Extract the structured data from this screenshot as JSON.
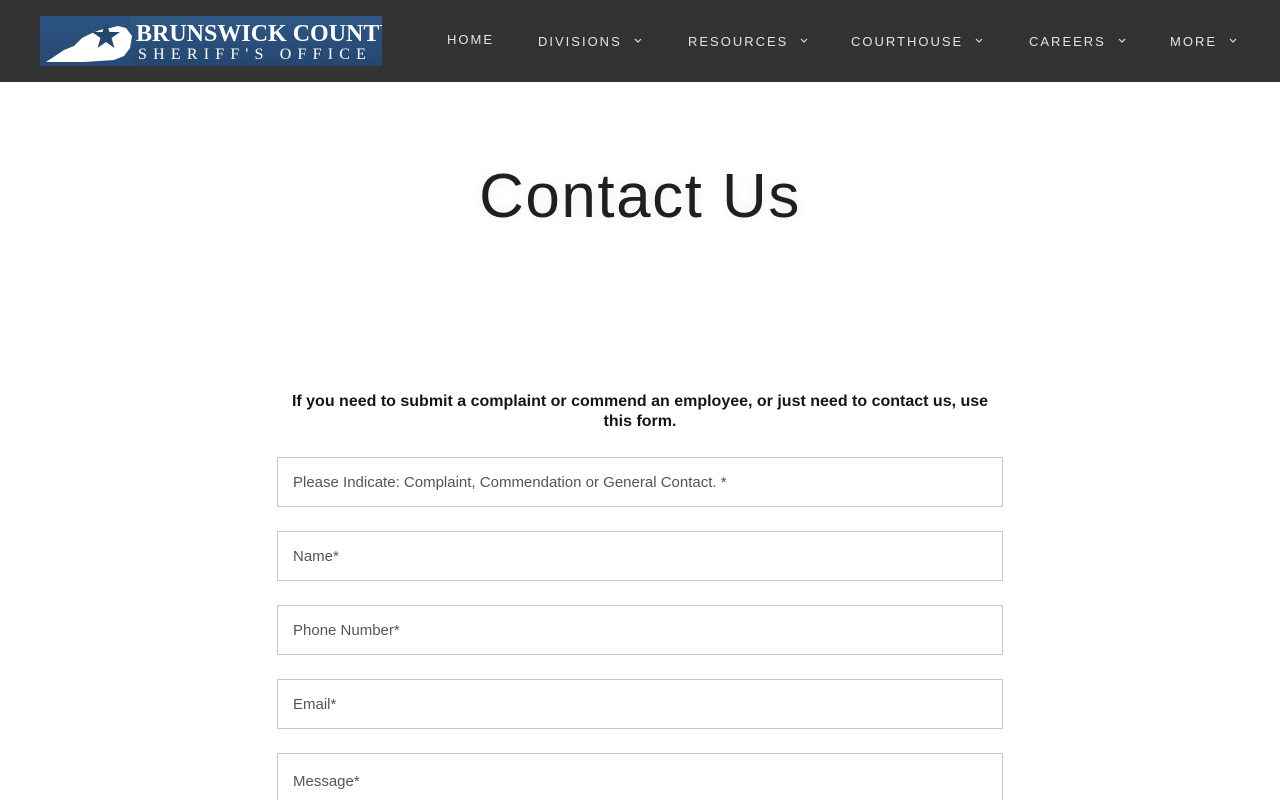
{
  "header": {
    "logo": {
      "line1": "BRUNSWICK COUNTY",
      "line2": "SHERIFF'S OFFICE",
      "background_color": "#2f5886",
      "icon": "virginia-state-star-icon"
    },
    "nav": [
      {
        "label": "HOME",
        "has_dropdown": false
      },
      {
        "label": "DIVISIONS",
        "has_dropdown": true
      },
      {
        "label": "RESOURCES",
        "has_dropdown": true
      },
      {
        "label": "COURTHOUSE",
        "has_dropdown": true
      },
      {
        "label": "CAREERS",
        "has_dropdown": true
      },
      {
        "label": "MORE",
        "has_dropdown": true
      }
    ],
    "background_color": "#333333",
    "dropdown_icon": "chevron-down-icon"
  },
  "main": {
    "title": "Contact Us",
    "intro": "If you need to submit a complaint or commend an employee, or just need to contact us, use this form.",
    "form": {
      "fields": [
        {
          "placeholder": "Please Indicate: Complaint, Commendation or General Contact. *",
          "value": ""
        },
        {
          "placeholder": "Name*",
          "value": ""
        },
        {
          "placeholder": "Phone Number*",
          "value": ""
        },
        {
          "placeholder": "Email*",
          "value": ""
        },
        {
          "placeholder": "Message*",
          "value": ""
        }
      ]
    }
  }
}
